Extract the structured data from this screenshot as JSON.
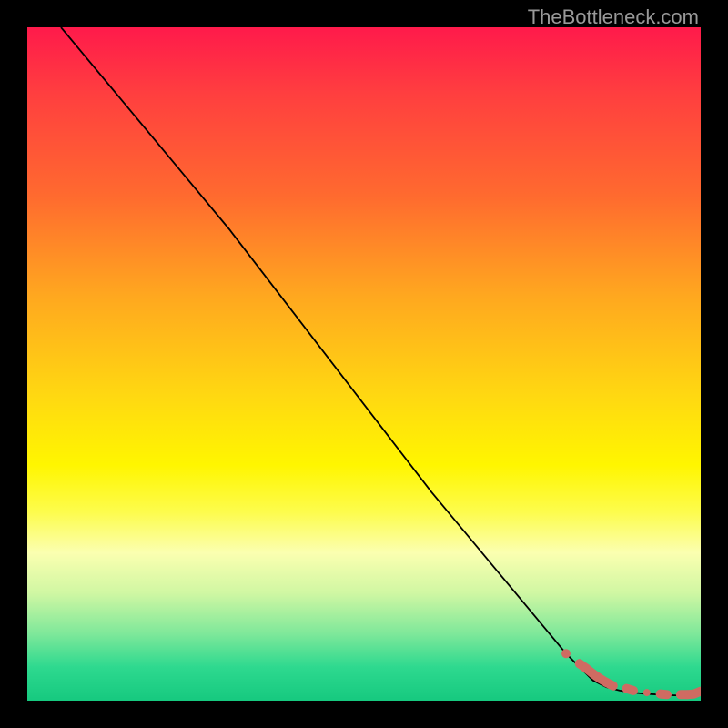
{
  "watermark": "TheBottleneck.com",
  "chart_data": {
    "type": "line",
    "title": "",
    "xlabel": "",
    "ylabel": "",
    "xlim": [
      0,
      100
    ],
    "ylim": [
      0,
      100
    ],
    "curve": {
      "x": [
        5,
        10,
        20,
        25,
        30,
        40,
        50,
        60,
        70,
        80,
        84,
        86,
        88,
        90,
        92,
        94,
        96,
        98,
        100
      ],
      "y": [
        100,
        94,
        82,
        76,
        70,
        57,
        44,
        31,
        19,
        7,
        3,
        2,
        1.5,
        1.2,
        1.0,
        0.9,
        0.8,
        0.8,
        1.2
      ]
    },
    "dots": {
      "x": [
        80,
        82,
        83,
        84,
        85,
        86,
        87,
        89,
        90,
        92,
        94,
        95,
        97,
        98,
        99,
        100
      ],
      "y": [
        7.0,
        5.5,
        4.8,
        4.0,
        3.3,
        2.7,
        2.2,
        1.8,
        1.5,
        1.2,
        1.0,
        0.9,
        0.9,
        0.9,
        1.0,
        1.4
      ],
      "color": "#cf6b62",
      "r_small": 4,
      "r_segment_end": 5
    }
  }
}
